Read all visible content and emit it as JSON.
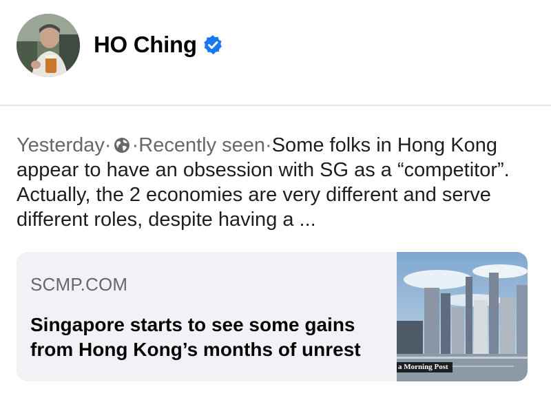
{
  "post": {
    "author": "HO Ching",
    "timestamp": "Yesterday",
    "separator": "·",
    "status": "Recently seen",
    "text": "Some folks in Hong Kong appear to have an obsession with SG as a “competitor”.  Actually, the 2 economies are very different and serve different roles, despite having a ...",
    "audience_icon": "globe-icon",
    "badge_icon": "verified-icon"
  },
  "link_preview": {
    "domain": "SCMP.COM",
    "title": "Singapore starts to see some gains from Hong Kong’s months of unrest",
    "thumbnail_caption": "a Morning Post"
  },
  "colors": {
    "verified": "#1877f2",
    "meta_text": "#65676b",
    "card_bg": "#f0f2f5"
  }
}
